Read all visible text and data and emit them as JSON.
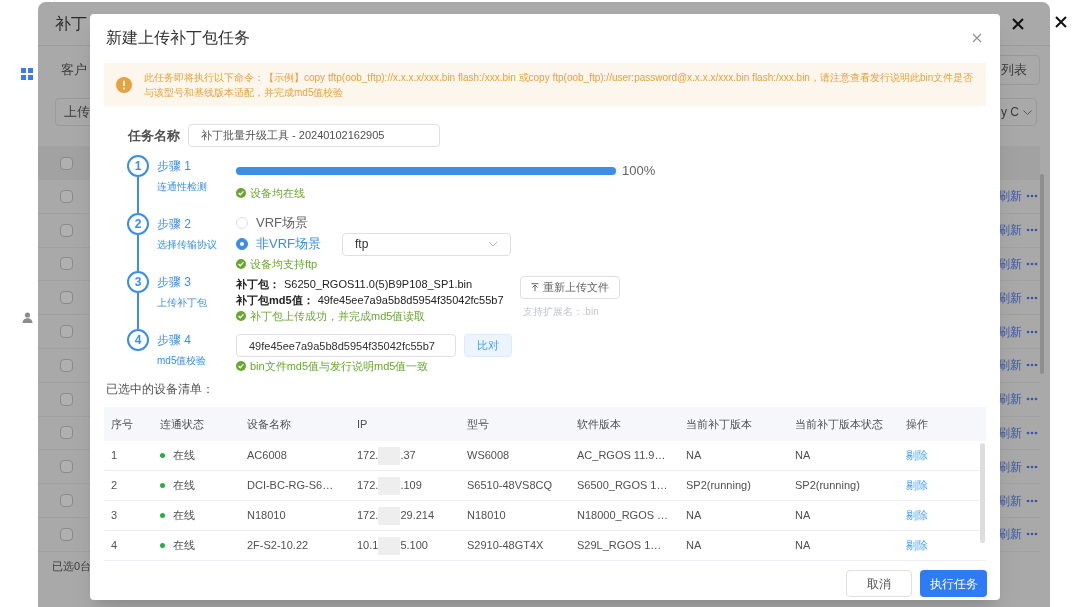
{
  "background_dialog": {
    "title": "补丁",
    "tab": "客户",
    "list_button": "列表",
    "select_left": "上传",
    "select_right": "y C",
    "header_checked": false,
    "rows": [
      {
        "checked": false,
        "action": "刷新"
      },
      {
        "checked": false,
        "action": "刷新"
      },
      {
        "checked": false,
        "action": "刷新"
      },
      {
        "checked": false,
        "action": "刷新"
      },
      {
        "checked": false,
        "action": "刷新"
      },
      {
        "checked": false,
        "action": "刷新"
      },
      {
        "checked": false,
        "action": "刷新"
      },
      {
        "checked": false,
        "action": "刷新"
      },
      {
        "checked": false,
        "action": "刷新"
      },
      {
        "checked": false,
        "action": "刷新"
      },
      {
        "checked": false,
        "action": "刷新"
      }
    ],
    "footer": "已选0台"
  },
  "modal": {
    "title": "新建上传补丁包任务",
    "alert": "此任务即将执行以下命令：【示例】copy tftp(oob_tftp)://x.x.x.x/xxx.bin flash:/xxx.bin 或copy ftp(oob_ftp)://user:password@x.x.x.x/xxx.bin flash:/xxx.bin，请注意查看发行说明此bin文件是否与该型号和基线版本适配，并完成md5值校验",
    "task_name": {
      "label": "任务名称",
      "value": "补丁批量升级工具 - 20240102162905"
    },
    "steps": [
      {
        "kind": "progress",
        "number": "1",
        "title": "步骤 1",
        "subtitle": "连通性检测",
        "level": 1,
        "reading": "100%",
        "message": "设备均在线"
      },
      {
        "kind": "protocol",
        "number": "2",
        "title": "步骤 2",
        "subtitle": "选择传输协议",
        "options": [
          {
            "label": "VRF场景",
            "selected": false
          },
          {
            "label": "非VRF场景",
            "selected": true
          }
        ],
        "protocol": "ftp",
        "message": "设备均支持ftp"
      },
      {
        "kind": "upload",
        "number": "3",
        "title": "步骤 3",
        "subtitle": "上传补丁包",
        "package_label": "补丁包：",
        "package": "S6250_RGOS11.0(5)B9P108_SP1.bin",
        "md5_label": "补丁包md5值：",
        "md5": "49fe45ee7a9a5b8d5954f35042fc55b7",
        "button": "重新上传文件",
        "hint": "支持扩展名：.bin",
        "message": "补丁包上传成功，并完成md5值读取"
      },
      {
        "kind": "verify",
        "number": "4",
        "title": "步骤 4",
        "subtitle": "md5值校验",
        "value": "49fe45ee7a9a5b8d5954f35042fc55b7",
        "button": "比对",
        "message": "bin文件md5值与发行说明md5值一致"
      }
    ],
    "list_title": "已选中的设备清单：",
    "table": {
      "columns": [
        "序号",
        "连通状态",
        "设备名称",
        "IP",
        "型号",
        "软件版本",
        "当前补丁版本",
        "当前补丁版本状态",
        "操作"
      ],
      "rows": [
        {
          "index": "1",
          "online": true,
          "status": "在线",
          "name": "AC6008",
          "ip_start": "172.",
          "ip_end": ".37",
          "model": "WS6008",
          "software": "AC_RGOS 11.9…",
          "patch": "NA",
          "patch_status": "NA",
          "action": "剔除"
        },
        {
          "index": "2",
          "online": true,
          "status": "在线",
          "name": "DCI-BC-RG-S6…",
          "ip_start": "172.",
          "ip_end": ".109",
          "model": "S6510-48VS8CQ",
          "software": "S6500_RGOS 1…",
          "patch": "SP2(running)",
          "patch_status": "SP2(running)",
          "action": "剔除"
        },
        {
          "index": "3",
          "online": true,
          "status": "在线",
          "name": "N18010",
          "ip_start": "172.",
          "ip_end": "29.214",
          "model": "N18010",
          "software": "N18000_RGOS …",
          "patch": "NA",
          "patch_status": "NA",
          "action": "剔除"
        },
        {
          "index": "4",
          "online": true,
          "status": "在线",
          "name": "2F-S2-10.22",
          "ip_start": "10.1",
          "ip_end": "5.100",
          "model": "S2910-48GT4X",
          "software": "S29L_RGOS 1…",
          "patch": "NA",
          "patch_status": "NA",
          "action": "剔除"
        }
      ]
    },
    "buttons": {
      "cancel": "取消",
      "submit": "执行任务"
    }
  }
}
